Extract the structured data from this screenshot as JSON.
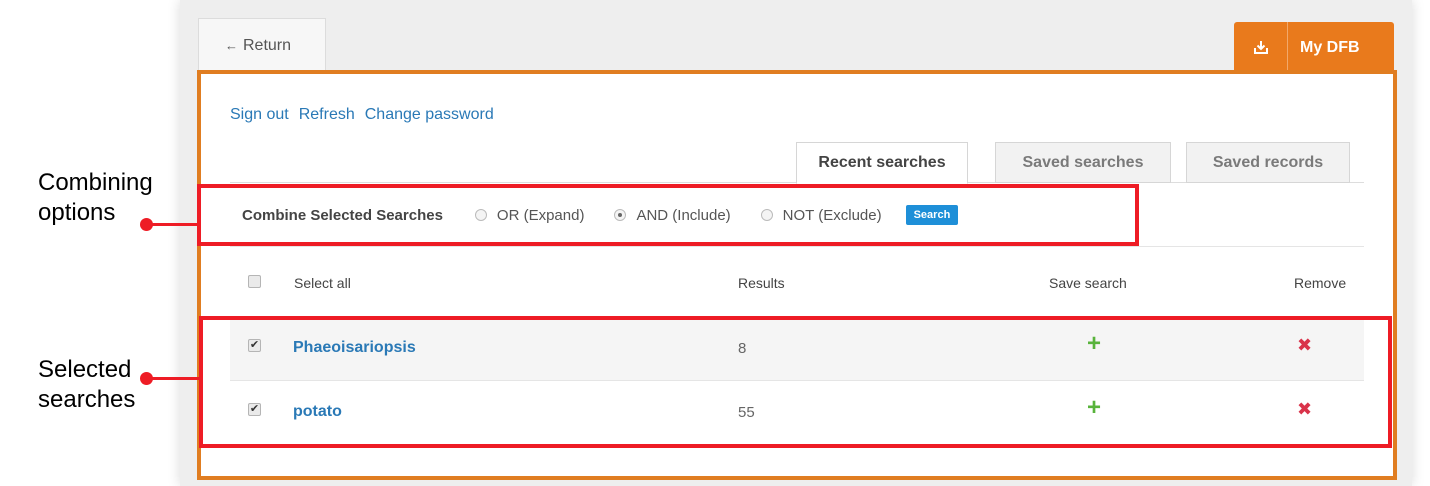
{
  "header": {
    "return_label": "Return",
    "mydfb_label": "My DFB"
  },
  "links": [
    "Sign out",
    "Refresh",
    "Change password"
  ],
  "tabs": [
    {
      "label": "Recent searches",
      "active": true
    },
    {
      "label": "Saved searches",
      "active": false
    },
    {
      "label": "Saved records",
      "active": false
    }
  ],
  "combine": {
    "label": "Combine Selected Searches",
    "options": [
      {
        "label": "OR (Expand)",
        "checked": false
      },
      {
        "label": "AND (Include)",
        "checked": true
      },
      {
        "label": "NOT (Exclude)",
        "checked": false
      }
    ],
    "button_label": "Search"
  },
  "table": {
    "headers": {
      "select_all": "Select all",
      "results": "Results",
      "save_search": "Save search",
      "remove": "Remove"
    },
    "rows": [
      {
        "term": "Phaeoisariopsis",
        "results": "8",
        "checked": true
      },
      {
        "term": "potato",
        "results": "55",
        "checked": true
      }
    ]
  },
  "annotations": {
    "combining": [
      "Combining",
      "options"
    ],
    "selected": [
      "Selected",
      "searches"
    ]
  },
  "colors": {
    "accent_orange": "#e07d21",
    "link_blue": "#2a79b6",
    "annotation_red": "#ee1c25",
    "add_green": "#58b33b",
    "remove_red": "#d9334a"
  }
}
